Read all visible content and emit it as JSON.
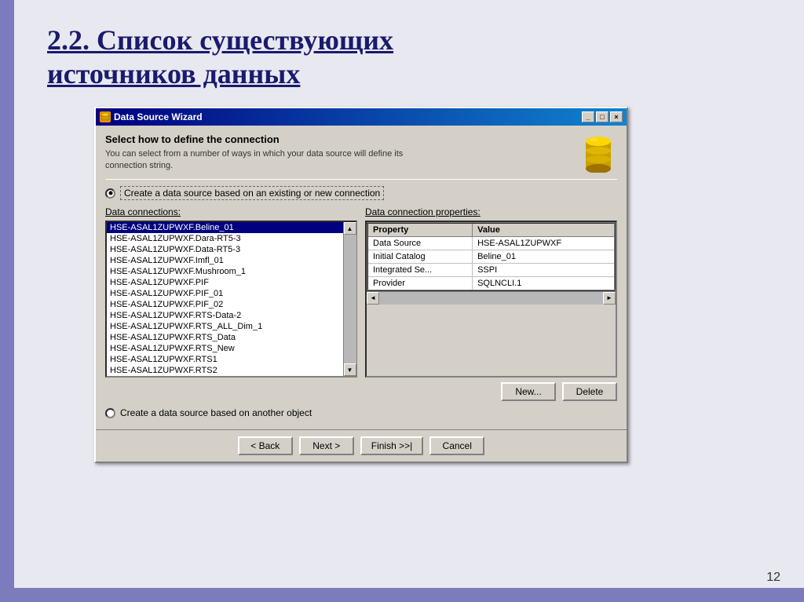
{
  "slide": {
    "title_line1": "2.2. Список существующих",
    "title_line2": "источников данных",
    "page_number": "12"
  },
  "dialog": {
    "title": "Data Source Wizard",
    "titlebar_controls": [
      "_",
      "□",
      "×"
    ],
    "header": {
      "heading": "Select how to define the connection",
      "description_line1": "You can select from a number of ways in which your data source will define its",
      "description_line2": "connection string."
    },
    "radio1": {
      "label": "Create a data source based on an existing or new connection",
      "selected": true
    },
    "radio2": {
      "label": "Create a data source based on another object",
      "selected": false
    },
    "left_panel": {
      "label": "Data connections:",
      "items": [
        "HSE-ASAL1ZUPWXF.Beline_01",
        "HSE-ASAL1ZUPWXF.Dara-RT5-3",
        "HSE-ASAL1ZUPWXF.Data-RT5-3",
        "HSE-ASAL1ZUPWXF.Imfl_01",
        "HSE-ASAL1ZUPWXF.Mushroom_1",
        "HSE-ASAL1ZUPWXF.PIF",
        "HSE-ASAL1ZUPWXF.PIF_01",
        "HSE-ASAL1ZUPWXF.PIF_02",
        "HSE-ASAL1ZUPWXF.RTS-Data-2",
        "HSE-ASAL1ZUPWXF.RTS_ALL_Dim_1",
        "HSE-ASAL1ZUPWXF.RTS_Data",
        "HSE-ASAL1ZUPWXF.RTS_New",
        "HSE-ASAL1ZUPWXF.RTS1",
        "HSE-ASAL1ZUPWXF.RTS2"
      ],
      "selected_index": 0
    },
    "right_panel": {
      "label": "Data connection properties:",
      "columns": [
        "Property",
        "Value"
      ],
      "rows": [
        [
          "Data Source",
          "HSE-ASAL1ZUPWXF"
        ],
        [
          "Initial Catalog",
          "Beline_01"
        ],
        [
          "Integrated Se...",
          "SSPI"
        ],
        [
          "Provider",
          "SQLNCLI.1"
        ]
      ]
    },
    "buttons": {
      "new": "New...",
      "delete": "Delete",
      "back": "< Back",
      "next": "Next >",
      "finish": "Finish >>|",
      "cancel": "Cancel"
    }
  }
}
